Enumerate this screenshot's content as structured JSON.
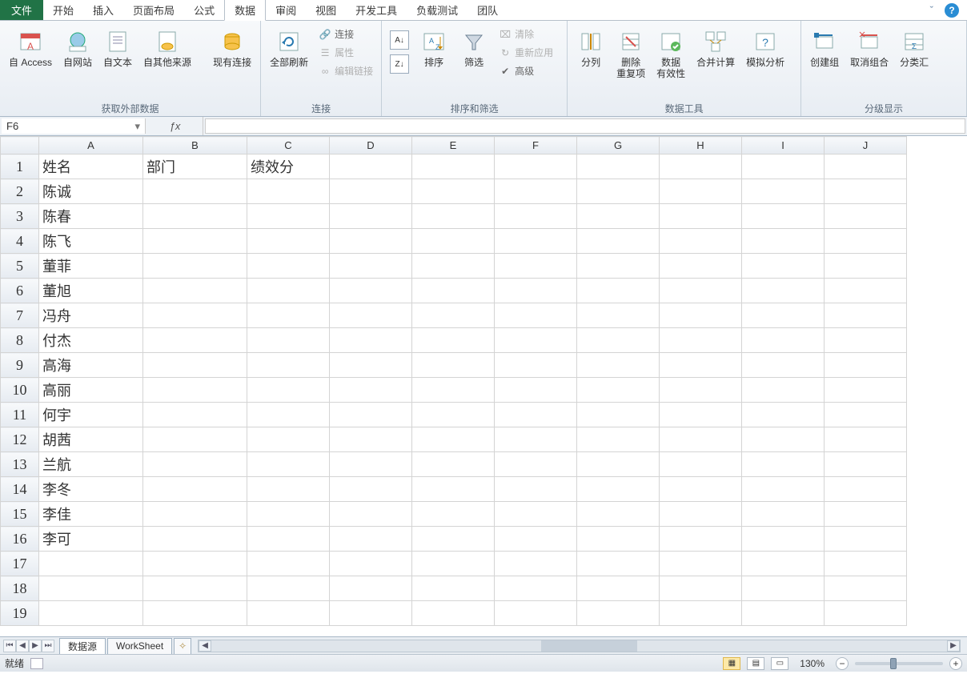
{
  "menu": {
    "file": "文件",
    "tabs": [
      "开始",
      "插入",
      "页面布局",
      "公式",
      "数据",
      "审阅",
      "视图",
      "开发工具",
      "负载测试",
      "团队"
    ],
    "active_index": 4
  },
  "ribbon": {
    "groups": {
      "get_external": {
        "label": "获取外部数据",
        "btns": {
          "access": "自 Access",
          "web": "自网站",
          "text": "自文本",
          "other": "自其他来源",
          "existing": "现有连接"
        }
      },
      "connections": {
        "label": "连接",
        "refresh": "全部刷新",
        "mini": {
          "conn": "连接",
          "props": "属性",
          "editlinks": "编辑链接"
        }
      },
      "sort_filter": {
        "label": "排序和筛选",
        "sort_az": "A→Z",
        "sort_za": "Z→A",
        "sort": "排序",
        "filter": "筛选",
        "mini": {
          "clear": "清除",
          "reapply": "重新应用",
          "advanced": "高级"
        }
      },
      "data_tools": {
        "label": "数据工具",
        "split": "分列",
        "dedup": "删除\n重复项",
        "validate": "数据\n有效性",
        "consolidate": "合并计算",
        "whatif": "模拟分析"
      },
      "outline": {
        "label": "分级显示",
        "group": "创建组",
        "ungroup": "取消组合",
        "subtotal": "分类汇"
      }
    }
  },
  "namebox": "F6",
  "formula": "",
  "columns": [
    "A",
    "B",
    "C",
    "D",
    "E",
    "F",
    "G",
    "H",
    "I",
    "J"
  ],
  "rows": [
    {
      "n": 1,
      "A": "姓名",
      "B": "部门",
      "C": "绩效分"
    },
    {
      "n": 2,
      "A": "陈诚"
    },
    {
      "n": 3,
      "A": "陈春"
    },
    {
      "n": 4,
      "A": "陈飞"
    },
    {
      "n": 5,
      "A": "董菲"
    },
    {
      "n": 6,
      "A": "董旭"
    },
    {
      "n": 7,
      "A": "冯舟"
    },
    {
      "n": 8,
      "A": "付杰"
    },
    {
      "n": 9,
      "A": "高海"
    },
    {
      "n": 10,
      "A": "高丽"
    },
    {
      "n": 11,
      "A": "何宇"
    },
    {
      "n": 12,
      "A": "胡茜"
    },
    {
      "n": 13,
      "A": "兰航"
    },
    {
      "n": 14,
      "A": "李冬"
    },
    {
      "n": 15,
      "A": "李佳"
    },
    {
      "n": 16,
      "A": "李可"
    },
    {
      "n": 17
    },
    {
      "n": 18
    },
    {
      "n": 19
    }
  ],
  "sheets": {
    "active": "数据源",
    "others": [
      "WorkSheet"
    ]
  },
  "status": {
    "ready": "就绪",
    "zoom": "130%"
  }
}
